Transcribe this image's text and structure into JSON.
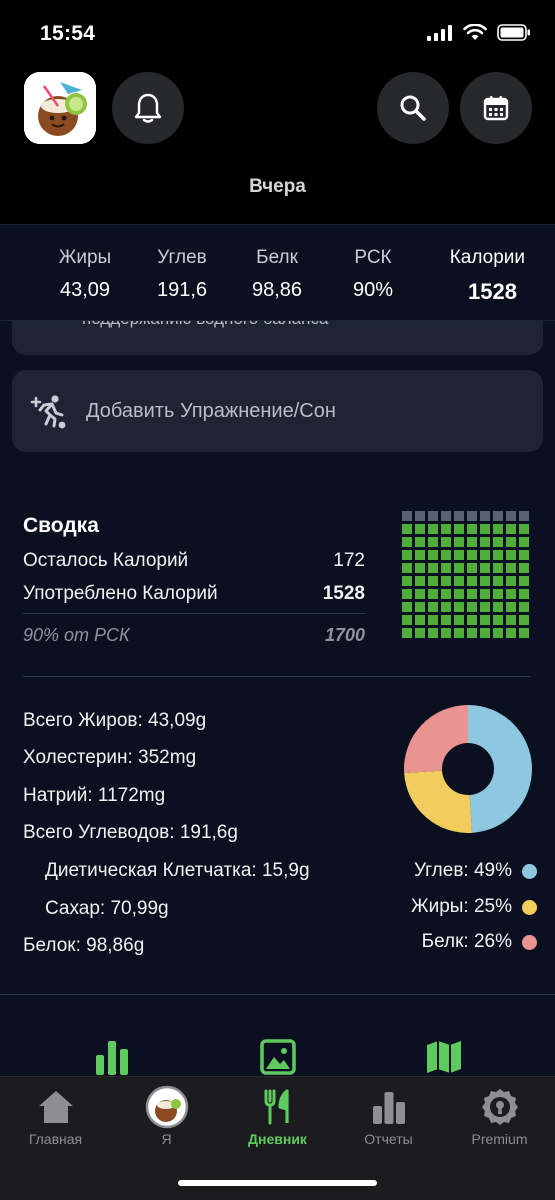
{
  "status": {
    "time": "15:54"
  },
  "header": {
    "title": "Вчера"
  },
  "macros": [
    {
      "label": "Жиры",
      "value": "43,09"
    },
    {
      "label": "Углев",
      "value": "191,6"
    },
    {
      "label": "Белк",
      "value": "98,86"
    },
    {
      "label": "РСК",
      "value": "90%"
    },
    {
      "label": "Калории",
      "value": "1528"
    }
  ],
  "partial_card": {
    "text": "поддержанию водного баланса"
  },
  "add_exercise": {
    "label": "Добавить Упражнение/Сон"
  },
  "summary": {
    "title": "Сводка",
    "remaining_label": "Осталось Калорий",
    "remaining_value": "172",
    "consumed_label": "Употреблено Калорий",
    "consumed_value": "1528",
    "rdi_label": "90% от РСК",
    "rdi_value": "1700",
    "waffle_filled_fraction": 0.9
  },
  "nutrients": {
    "fat": "Всего Жиров: 43,09g",
    "cholesterol": "Холестерин: 352mg",
    "sodium": "Натрий: 1172mg",
    "carbs": "Всего Углеводов: 191,6g",
    "fiber": "Диетическая Клетчатка: 15,9g",
    "sugar": "Сахар: 70,99g",
    "protein": "Белок: 98,86g"
  },
  "legend": {
    "carbs": "Углев: 49%",
    "fat": "Жиры: 25%",
    "protein": "Белк: 26%"
  },
  "chart_data": {
    "type": "pie",
    "categories": [
      "Углев",
      "Жиры",
      "Белк"
    ],
    "values": [
      49,
      25,
      26
    ],
    "colors": [
      "#8ec8e0",
      "#f2cc5c",
      "#e99490"
    ]
  },
  "tabs": [
    {
      "label": "Главная",
      "icon": "home-icon"
    },
    {
      "label": "Я",
      "icon": "avatar-icon"
    },
    {
      "label": "Дневник",
      "icon": "fork-knife-icon",
      "active": true
    },
    {
      "label": "Отчеты",
      "icon": "bar-chart-icon"
    },
    {
      "label": "Premium",
      "icon": "premium-badge-icon"
    }
  ],
  "colors": {
    "accent": "#5ecb5e",
    "card": "#1e2433",
    "background": "#0b1020",
    "waffle_filled": "#4fae3a",
    "waffle_empty": "#5a6170"
  }
}
